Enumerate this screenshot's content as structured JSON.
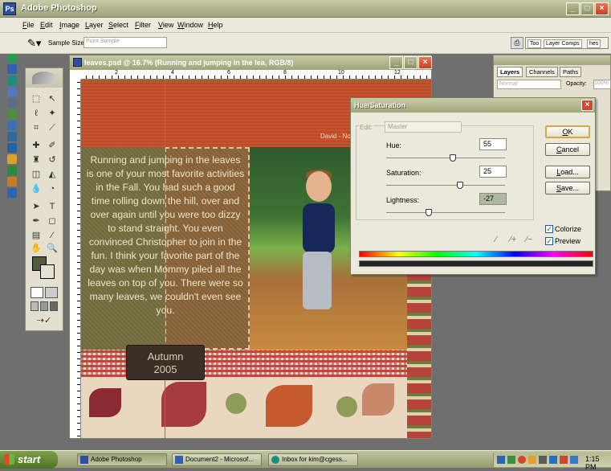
{
  "app": {
    "title": "Adobe Photoshop",
    "icon_letter": "Ps"
  },
  "window_controls": {
    "minimize": "_",
    "maximize": "□",
    "close": "×"
  },
  "menu": [
    "File",
    "Edit",
    "Image",
    "Layer",
    "Select",
    "Filter",
    "View",
    "Window",
    "Help"
  ],
  "options_bar": {
    "tool_icon": "eyedropper-icon",
    "sample_size_label": "Sample Size:",
    "sample_size_value": "Point Sample",
    "palette_well_tabs": [
      "Too",
      "Layer Comps",
      "hes"
    ]
  },
  "document": {
    "title": "leaves.psd @ 16.7% (Running and jumping in the lea, RGB/8)",
    "ruler_numbers": [
      "2",
      "4",
      "6",
      "8",
      "10",
      "12"
    ],
    "journal_text": "Running and jumping in the leaves is one of your most favorite activities in the Fall. You had such a good time rolling down the hill, over and over again until you were too dizzy to stand straight. You even convinced Christopher to join in the fun. I think your favorite part of the day was when Mommy piled all the leaves on top of you. There were so many leaves, we couldn't even see you.",
    "tag_line1": "Autumn",
    "tag_line2": "2005",
    "signature": "David - No"
  },
  "layers_palette": {
    "tabs": [
      "Layers",
      "Channels",
      "Paths"
    ],
    "blend_mode": "Normal",
    "opacity_label": "Opacity:",
    "opacity_value": "100%"
  },
  "hue_saturation": {
    "title": "Hue/Saturation",
    "edit_label": "Edit:",
    "edit_value": "Master",
    "hue_label": "Hue:",
    "hue_value": "55",
    "saturation_label": "Saturation:",
    "saturation_value": "25",
    "lightness_label": "Lightness:",
    "lightness_value": "-27",
    "hue_level": 0.56,
    "saturation_level": 0.62,
    "lightness_level": 0.36,
    "buttons": {
      "ok": "OK",
      "cancel": "Cancel",
      "load": "Load...",
      "save": "Save..."
    },
    "colorize_label": "Colorize",
    "preview_label": "Preview",
    "colorize_checked": true,
    "preview_checked": true
  },
  "taskbar": {
    "start_label": "start",
    "tasks": [
      "Adobe Photoshop",
      "Document2 - Microsof...",
      "Inbox for kim@cgess..."
    ],
    "clock": "1:15 PM"
  },
  "colors": {
    "accent": "#9fa47a",
    "start_green": "#4b7424",
    "canvas_orange": "#c7522f"
  }
}
